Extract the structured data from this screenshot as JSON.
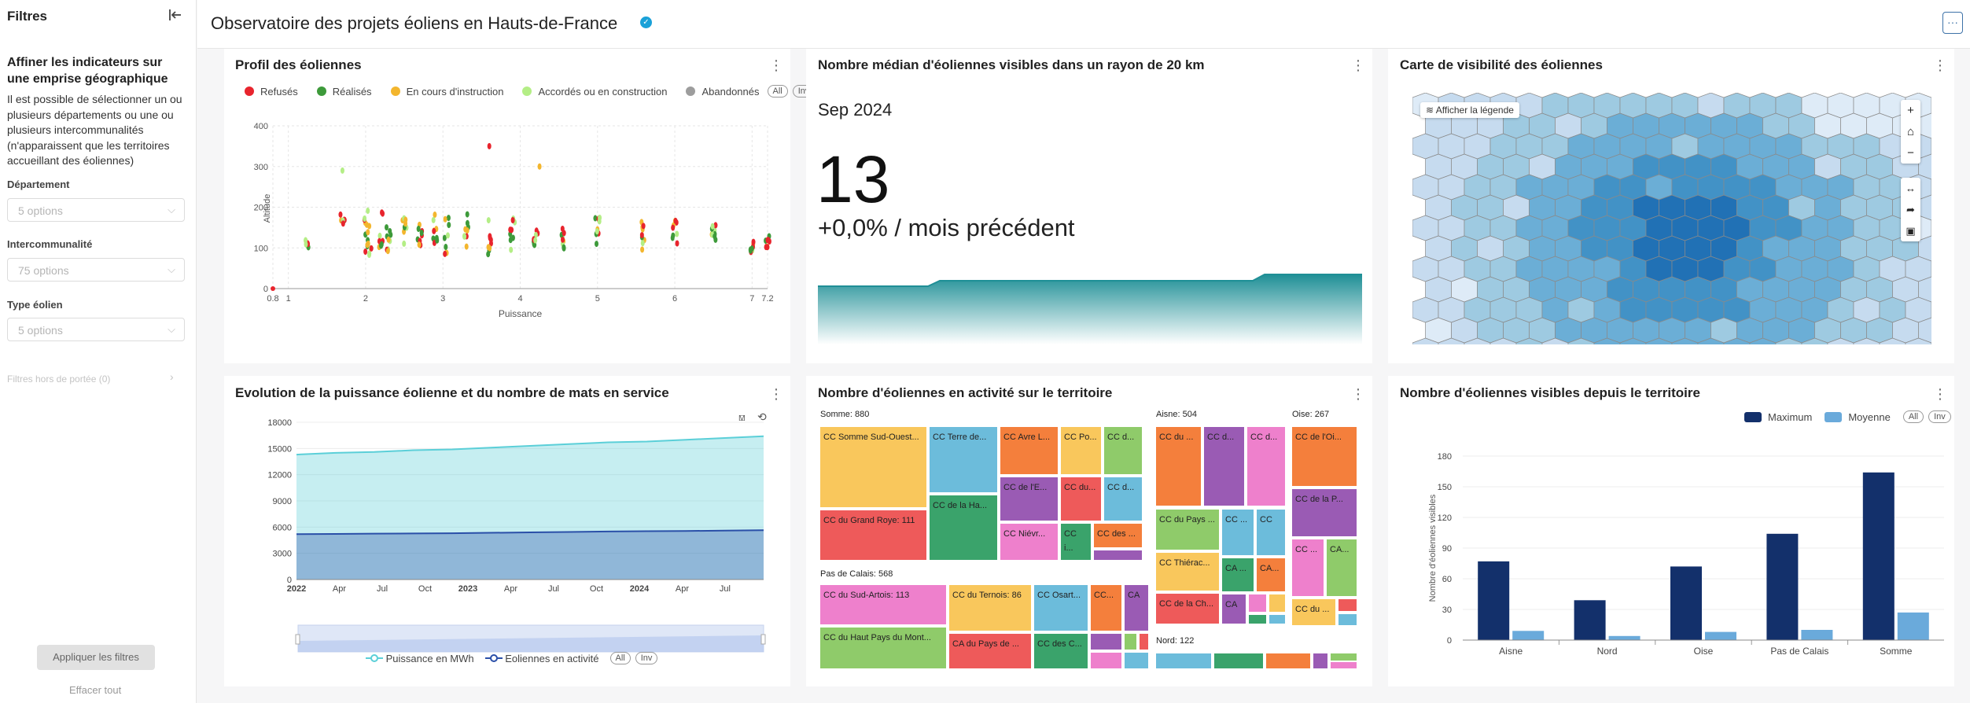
{
  "sidebar": {
    "title": "Filtres",
    "collapse_icon": "collapse-left-icon",
    "heading": "Affiner les indicateurs sur une emprise géographique",
    "description": "Il est possible de sélectionner un ou plusieurs départements ou une ou plusieurs intercommunalités (n'apparaissent que les territoires accueillant des éoliennes)",
    "filters": [
      {
        "label": "Département",
        "placeholder": "5 options"
      },
      {
        "label": "Intercommunalité",
        "placeholder": "75 options"
      },
      {
        "label": "Type éolien",
        "placeholder": "5 options"
      }
    ],
    "out_of_scope": "Filtres hors de portée (0)",
    "apply": "Appliquer les filtres",
    "clear": "Effacer tout"
  },
  "header": {
    "title": "Observatoire des projets éoliens en Hauts-de-France",
    "more": "···"
  },
  "scatter": {
    "title": "Profil des éoliennes",
    "legend_all": "All",
    "legend_inv": "Inv",
    "chart_data": {
      "type": "scatter",
      "xlabel": "Puissance",
      "ylabel": "Altitude",
      "xlim": [
        0.8,
        7.2
      ],
      "ylim": [
        0,
        400
      ],
      "x_ticks": [
        "0.8",
        "1",
        "2",
        "3",
        "4",
        "5",
        "6",
        "7",
        "7.2"
      ],
      "y_ticks": [
        "0",
        "100",
        "200",
        "300",
        "400"
      ],
      "series": [
        {
          "name": "Refusés",
          "color": "#e8242d"
        },
        {
          "name": "Réalisés",
          "color": "#3d9a3a"
        },
        {
          "name": "En cours d'instruction",
          "color": "#f3b62e"
        },
        {
          "name": "Accordés ou en construction",
          "color": "#b4ee86"
        },
        {
          "name": "Abandonnés",
          "color": "#9d9d9d"
        }
      ],
      "grid": true,
      "legend": "top"
    }
  },
  "kpi": {
    "title": "Nombre médian d'éoliennes visibles dans un rayon de 20 km",
    "date": "Sep 2024",
    "value": "13",
    "change": "+0,0% / mois précédent",
    "sparkline_color": "#1f8f96"
  },
  "map": {
    "title": "Carte de visibilité des éoliennes",
    "legend_button": "Afficher la légende",
    "layers_icon": "layers-icon",
    "controls": [
      "zoom-in-icon",
      "home-icon",
      "zoom-out-icon",
      "measure-icon",
      "share-icon",
      "image-icon"
    ]
  },
  "area": {
    "title": "Evolution de la puissance éolienne et du nombre de mats en service",
    "legend": [
      "Puissance en MWh",
      "Eoliennes en activité"
    ],
    "legend_all": "All",
    "legend_inv": "Inv",
    "chart_data": {
      "type": "area",
      "y_ticks": [
        "0",
        "3000",
        "6000",
        "9000",
        "12000",
        "15000",
        "18000"
      ],
      "ylim": [
        0,
        18000
      ],
      "x_ticks": [
        "2022",
        "Apr",
        "Jul",
        "Oct",
        "2023",
        "Apr",
        "Jul",
        "Oct",
        "2024",
        "Apr",
        "Jul"
      ],
      "series": [
        {
          "name": "Puissance en MWh",
          "color": "#5bcfd8",
          "values": [
            14300,
            14500,
            14600,
            14800,
            14900,
            15100,
            15300,
            15500,
            15700,
            15800,
            16000,
            16200,
            16400
          ]
        },
        {
          "name": "Eoliennes en activité",
          "color": "#2a4fa8",
          "values": [
            5200,
            5220,
            5250,
            5280,
            5300,
            5350,
            5400,
            5450,
            5500,
            5530,
            5560,
            5600,
            5650
          ]
        }
      ],
      "grid": true
    }
  },
  "treemap": {
    "title": "Nombre d'éoliennes en activité sur le territoire",
    "groups": [
      "Somme: 880",
      "Aisne: 504",
      "Oise: 267",
      "Pas de Calais: 568",
      "Nord: 122"
    ],
    "labels": [
      "CC Somme Sud-Ouest...",
      "CC Terre de...",
      "CC Avre L...",
      "CC Po...",
      "CC d...",
      "CC de l'E...",
      "CC du...",
      "CC de la Ha...",
      "CC du Grand Roye: 111",
      "CC Niévr...",
      "CC i...",
      "CC des ...",
      "CC du ...",
      "CC d...",
      "CC d...",
      "CC de l'Oi...",
      "CC du Pays ...",
      "CC ...",
      "CC",
      "CC de la P...",
      "CC Thiérac...",
      "CA ...",
      "CC ...",
      "CA...",
      "CA...",
      "CC de la Ch...",
      "CA",
      "CC du ...",
      "CC du Sud-Artois: 113",
      "CC du Ternois: 86",
      "CC Osart...",
      "CC...",
      "CA",
      "CC du Haut Pays du Mont...",
      "CA du Pays de ...",
      "CC des C..."
    ]
  },
  "bars": {
    "title": "Nombre d'éoliennes visibles depuis le territoire",
    "legend_all": "All",
    "legend_inv": "Inv",
    "chart_data": {
      "type": "bar",
      "categories": [
        "Aisne",
        "Nord",
        "Oise",
        "Pas de Calais",
        "Somme"
      ],
      "series": [
        {
          "name": "Maximum",
          "color": "#13306b",
          "values": [
            77,
            39,
            72,
            104,
            164
          ]
        },
        {
          "name": "Moyenne",
          "color": "#6aaadb",
          "values": [
            9,
            4,
            8,
            10,
            27
          ]
        }
      ],
      "ylabel": "Nombre d'éoliennes visibles",
      "ylim": [
        0,
        180
      ],
      "y_ticks": [
        "0",
        "30",
        "60",
        "90",
        "120",
        "150",
        "180"
      ],
      "grid": true,
      "legend": "top-right"
    }
  }
}
